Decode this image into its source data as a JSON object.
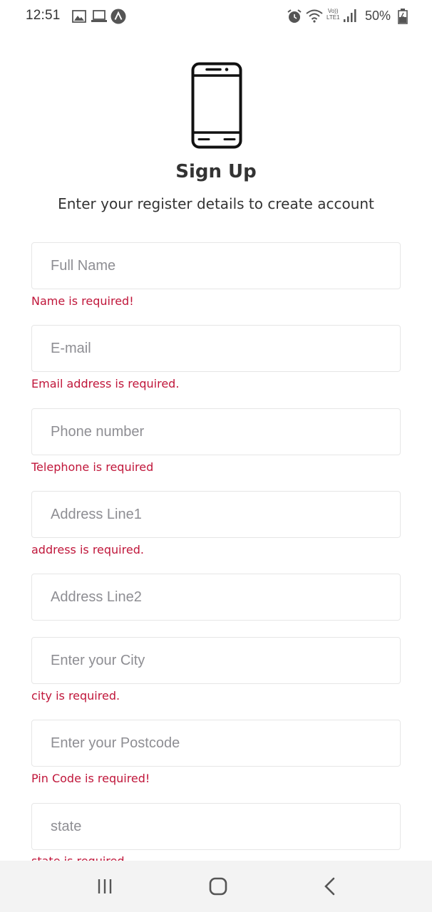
{
  "status_bar": {
    "time": "12:51",
    "battery": "50%",
    "volte_top": "Vo))",
    "volte_bottom": "LTE1",
    "icons": [
      "gallery-icon",
      "laptop-icon",
      "app-a-icon",
      "alarm-icon",
      "wifi-icon",
      "signal-icon",
      "battery-icon"
    ]
  },
  "header": {
    "title": "Sign Up",
    "subtitle": "Enter your register details to create account"
  },
  "form": {
    "full_name": {
      "placeholder": "Full Name",
      "error": "Name is required!"
    },
    "email": {
      "placeholder": "E-mail",
      "error": "Email address is required."
    },
    "phone": {
      "placeholder": "Phone number",
      "error": "Telephone is required"
    },
    "address1": {
      "placeholder": "Address Line1",
      "error": "address is required."
    },
    "address2": {
      "placeholder": "Address Line2"
    },
    "city": {
      "placeholder": "Enter your City",
      "error": "city is required."
    },
    "postcode": {
      "placeholder": "Enter your Postcode",
      "error": "Pin Code is required!"
    },
    "state": {
      "placeholder": "state",
      "error": "state is required"
    }
  },
  "nav_bar": {
    "icons": [
      "recent-apps-icon",
      "home-icon",
      "back-icon"
    ]
  },
  "colors": {
    "error": "#c0163a",
    "text": "#333333",
    "border": "#e6e6e6",
    "nav_bg": "#f3f3f3"
  }
}
